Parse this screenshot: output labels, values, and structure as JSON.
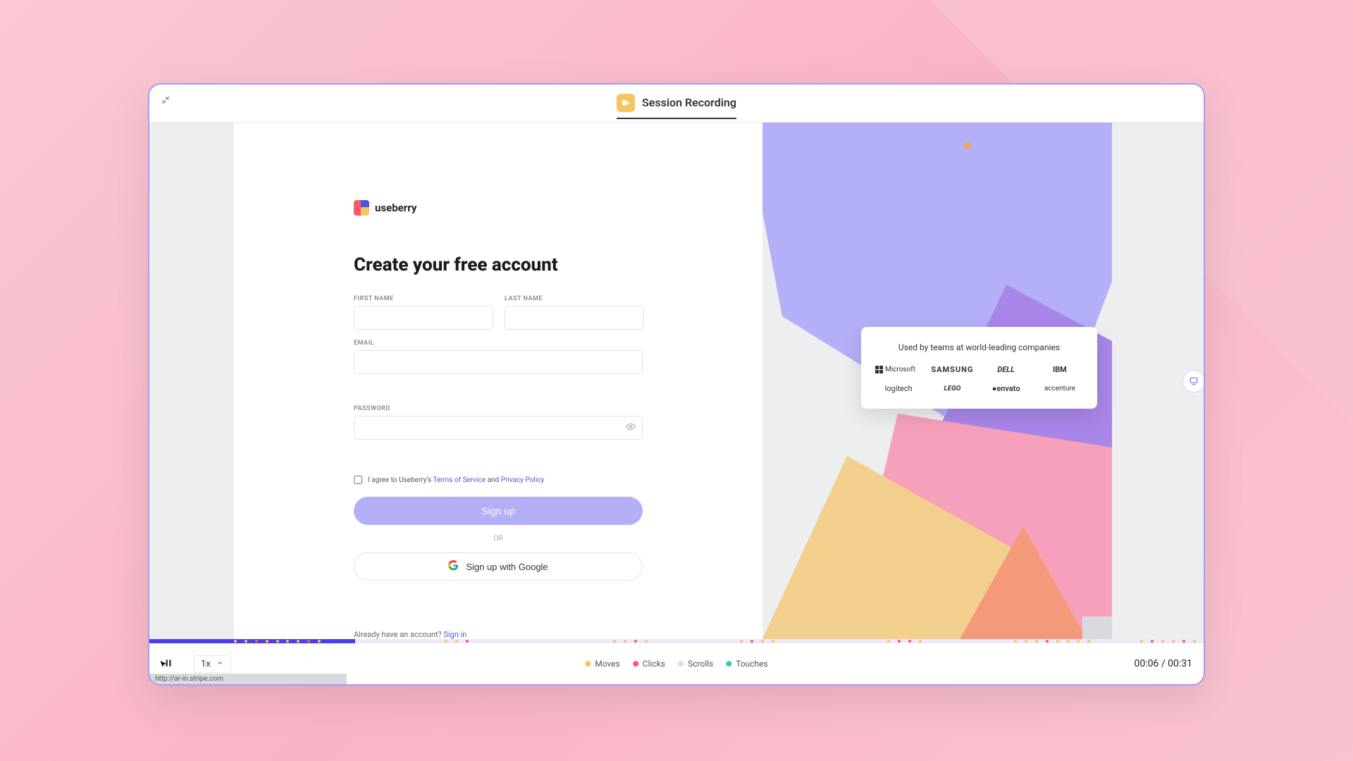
{
  "header": {
    "tab_label": "Session Recording"
  },
  "signup": {
    "brand": "useberry",
    "title": "Create your free account",
    "labels": {
      "first_name": "FIRST NAME",
      "last_name": "LAST NAME",
      "email": "EMAIL",
      "password": "PASSWORD"
    },
    "consent_prefix": "I agree to Useberry's ",
    "terms_label": "Terms of Service",
    "consent_mid": " and ",
    "privacy_label": "Privacy Policy",
    "signup_btn": "Sign up",
    "divider": "OR",
    "google_btn": "Sign up with Google",
    "already_text": "Already have an account? ",
    "signin_link": "Sign in"
  },
  "brands_card": {
    "title": "Used by teams at world-leading companies",
    "brands": [
      "Microsoft",
      "SAMSUNG",
      "DELL",
      "IBM",
      "logitech",
      "LEGO",
      "envato",
      "accenture"
    ]
  },
  "player": {
    "speed": "1x",
    "time_current": "00:06",
    "time_total": "00:31",
    "time_sep": " / ",
    "legend": {
      "moves": "Moves",
      "clicks": "Clicks",
      "scrolls": "Scrolls",
      "touches": "Touches"
    },
    "status": "http://ar-in.stripe.com"
  }
}
